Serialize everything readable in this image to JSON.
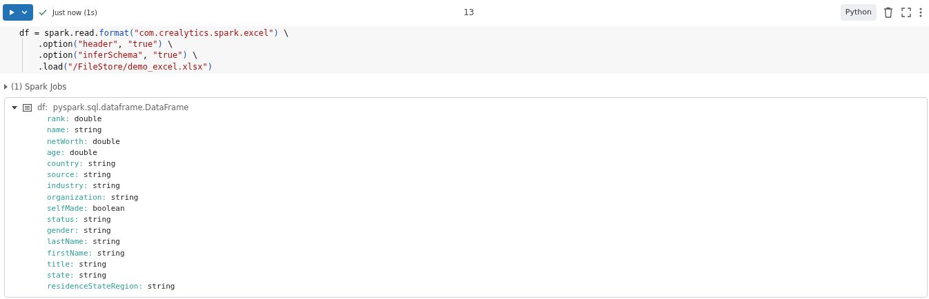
{
  "cell": {
    "status": "Just now (1s)",
    "status_ok": true,
    "number": "13",
    "language": "Python"
  },
  "code": [
    {
      "indented": false,
      "tokens": [
        {
          "kind": "plain",
          "text": "df = spark.read."
        },
        {
          "kind": "func",
          "text": "format"
        },
        {
          "kind": "paren",
          "text": "("
        },
        {
          "kind": "string",
          "text": "\"com.crealytics.spark.excel\""
        },
        {
          "kind": "paren",
          "text": ")"
        },
        {
          "kind": "plain",
          "text": " \\"
        }
      ]
    },
    {
      "indented": true,
      "tokens": [
        {
          "kind": "plain",
          "text": ".option"
        },
        {
          "kind": "paren",
          "text": "("
        },
        {
          "kind": "string",
          "text": "\"header\""
        },
        {
          "kind": "plain",
          "text": ", "
        },
        {
          "kind": "string",
          "text": "\"true\""
        },
        {
          "kind": "paren",
          "text": ")"
        },
        {
          "kind": "plain",
          "text": " \\"
        }
      ]
    },
    {
      "indented": true,
      "tokens": [
        {
          "kind": "plain",
          "text": ".option"
        },
        {
          "kind": "paren",
          "text": "("
        },
        {
          "kind": "string",
          "text": "\"inferSchema\""
        },
        {
          "kind": "plain",
          "text": ", "
        },
        {
          "kind": "string",
          "text": "\"true\""
        },
        {
          "kind": "paren",
          "text": ")"
        },
        {
          "kind": "plain",
          "text": " \\"
        }
      ]
    },
    {
      "indented": true,
      "tokens": [
        {
          "kind": "plain",
          "text": ".load"
        },
        {
          "kind": "paren",
          "text": "("
        },
        {
          "kind": "string",
          "text": "\"/FileStore/demo_excel.xlsx\""
        },
        {
          "kind": "paren",
          "text": ")"
        }
      ]
    }
  ],
  "spark_jobs": {
    "label": "(1) Spark Jobs",
    "expanded": false
  },
  "output": {
    "expanded": true,
    "variable": "df:",
    "type": "pyspark.sql.dataframe.DataFrame",
    "fields": [
      {
        "name": "rank:",
        "type": "double"
      },
      {
        "name": "name:",
        "type": "string"
      },
      {
        "name": "netWorth:",
        "type": "double"
      },
      {
        "name": "age:",
        "type": "double"
      },
      {
        "name": "country:",
        "type": "string"
      },
      {
        "name": "source:",
        "type": "string"
      },
      {
        "name": "industry:",
        "type": "string"
      },
      {
        "name": "organization:",
        "type": "string"
      },
      {
        "name": "selfMade:",
        "type": "boolean"
      },
      {
        "name": "status:",
        "type": "string"
      },
      {
        "name": "gender:",
        "type": "string"
      },
      {
        "name": "lastName:",
        "type": "string"
      },
      {
        "name": "firstName:",
        "type": "string"
      },
      {
        "name": "title:",
        "type": "string"
      },
      {
        "name": "state:",
        "type": "string"
      },
      {
        "name": "residenceStateRegion:",
        "type": "string"
      }
    ]
  }
}
